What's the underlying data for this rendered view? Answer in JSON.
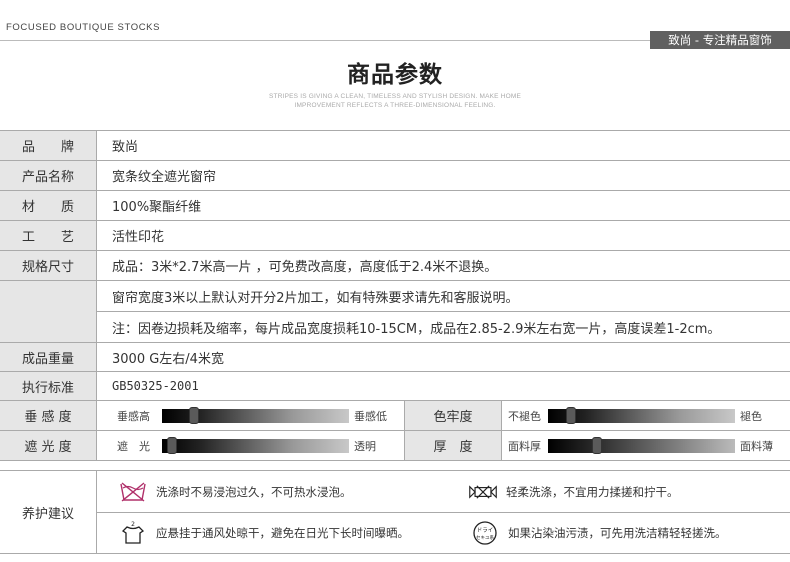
{
  "header": {
    "eng_tag": "FOCUSED BOUTIQUE STOCKS",
    "brand_tab": "致尚 - 专注精品窗饰",
    "title": "商品参数",
    "subtitle_line1": "STRIPES IS GIVING A CLEAN, TIMELESS AND STYLISH DESIGN. MAKE HOME",
    "subtitle_line2": "IMPROVEMENT REFLECTS A THREE-DIMENSIONAL FEELING."
  },
  "params": {
    "brand_label": "品　　牌",
    "brand_value": "致尚",
    "name_label": "产品名称",
    "name_value": "宽条纹全遮光窗帘",
    "material_label": "材　　质",
    "material_value": "100%聚酯纤维",
    "craft_label": "工　　艺",
    "craft_value": "活性印花",
    "spec_label": "规格尺寸",
    "spec_line1": "成品：3米*2.7米高一片 ，可免费改高度，高度低于2.4米不退换。",
    "spec_line2": "窗帘宽度3米以上默认对开分2片加工，如有特殊要求请先和客服说明。",
    "spec_line3": "注：因卷边损耗及缩率，每片成品宽度损耗10-15CM，成品在2.85-2.9米左右宽一片，高度误差1-2cm。",
    "weight_label": "成品重量",
    "weight_value": "3000 G左右/4米宽",
    "standard_label": "执行标准",
    "standard_value": "GB50325-2001"
  },
  "sliders": {
    "drape_label": "垂 感 度",
    "drape_left": "垂感高",
    "drape_right": "垂感低",
    "drape_level": 0.15,
    "fastness_label": "色牢度",
    "fastness_left": "不褪色",
    "fastness_right": "褪色",
    "fastness_level": 0.1,
    "shading_label": "遮 光 度",
    "shading_left": "遮　光",
    "shading_right": "透明",
    "shading_level": 0.03,
    "thickness_label": "厚　度",
    "thickness_left": "面料厚",
    "thickness_right": "面料薄",
    "thickness_level": 0.25
  },
  "care": {
    "label": "养护建议",
    "item1": "洗涤时不易浸泡过久，不可热水浸泡。",
    "item2": "轻柔洗涤，不宜用力揉搓和拧干。",
    "item3": "应悬挂于通风处晾干，避免在日光下长时间曝晒。",
    "item4": "如果沾染油污渍，可先用洗洁精轻轻搓洗。",
    "dry_clean_icon_text": "ドライ セキユ系"
  }
}
